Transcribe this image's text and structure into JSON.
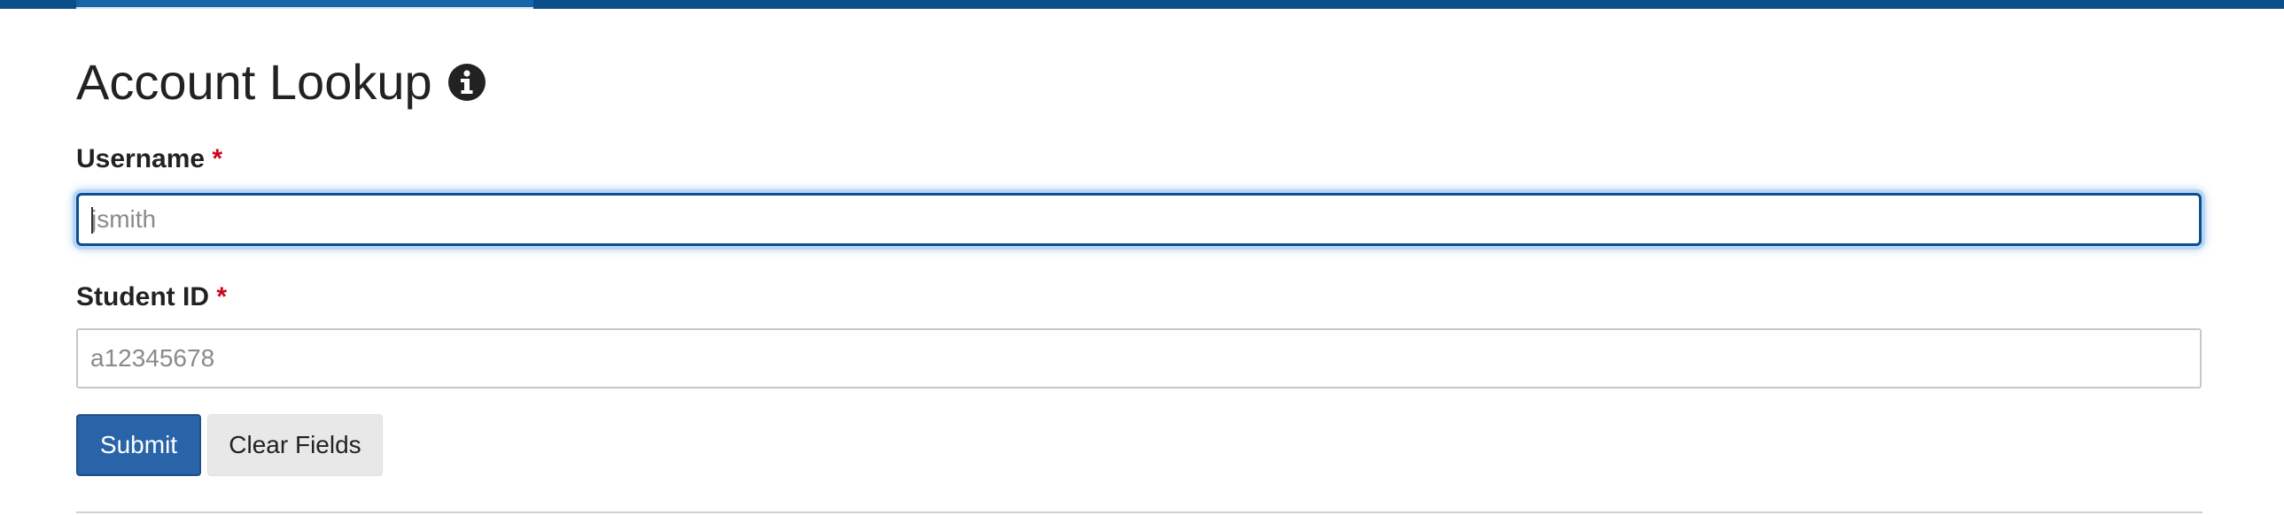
{
  "page": {
    "title": "Account Lookup",
    "info_icon": "info-circle-icon"
  },
  "form": {
    "username": {
      "label": "Username",
      "required_mark": "*",
      "value": "",
      "placeholder": "jsmith",
      "focused": true
    },
    "student_id": {
      "label": "Student ID",
      "required_mark": "*",
      "value": "",
      "placeholder": "a12345678"
    }
  },
  "buttons": {
    "submit": "Submit",
    "clear": "Clear Fields"
  },
  "colors": {
    "header_bar": "#0b4f8a",
    "submit_button": "#2a64a8",
    "required": "#d0021b",
    "focus_border": "#0c4f8f"
  }
}
